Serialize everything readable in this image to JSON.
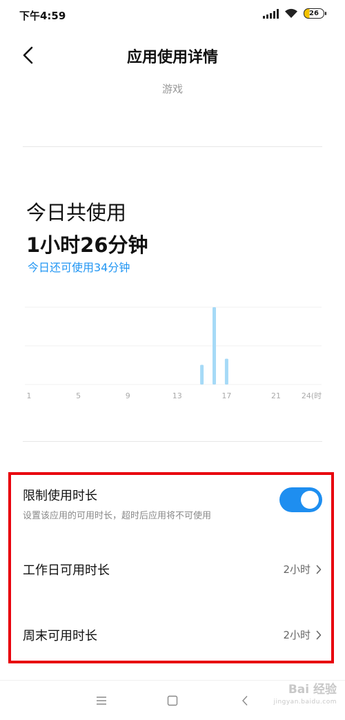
{
  "status_bar": {
    "time": "下午4:59",
    "battery": "26"
  },
  "header": {
    "title": "应用使用详情",
    "subtitle": "游戏"
  },
  "usage": {
    "heading": "今日共使用",
    "total": "1小时26分钟",
    "remaining": "今日还可使用34分钟"
  },
  "chart_data": {
    "type": "bar",
    "x_ticks": [
      "1",
      "5",
      "9",
      "13",
      "17",
      "21",
      "24(时)"
    ],
    "hours": [
      15,
      16,
      17
    ],
    "values": [
      13,
      51,
      17
    ],
    "ylim": [
      0,
      51
    ],
    "color": "#a6daf7",
    "grid": true
  },
  "settings": {
    "limit": {
      "title": "限制使用时长",
      "desc": "设置该应用的可用时长，超时后应用将不可使用",
      "enabled": true
    },
    "weekday": {
      "title": "工作日可用时长",
      "value": "2小时"
    },
    "weekend": {
      "title": "周末可用时长",
      "value": "2小时"
    }
  },
  "accent_color": "#1e8ef0",
  "highlight_color": "#e8000b",
  "watermark": {
    "brand": "Bai 经验",
    "url": "jingyan.baidu.com"
  }
}
